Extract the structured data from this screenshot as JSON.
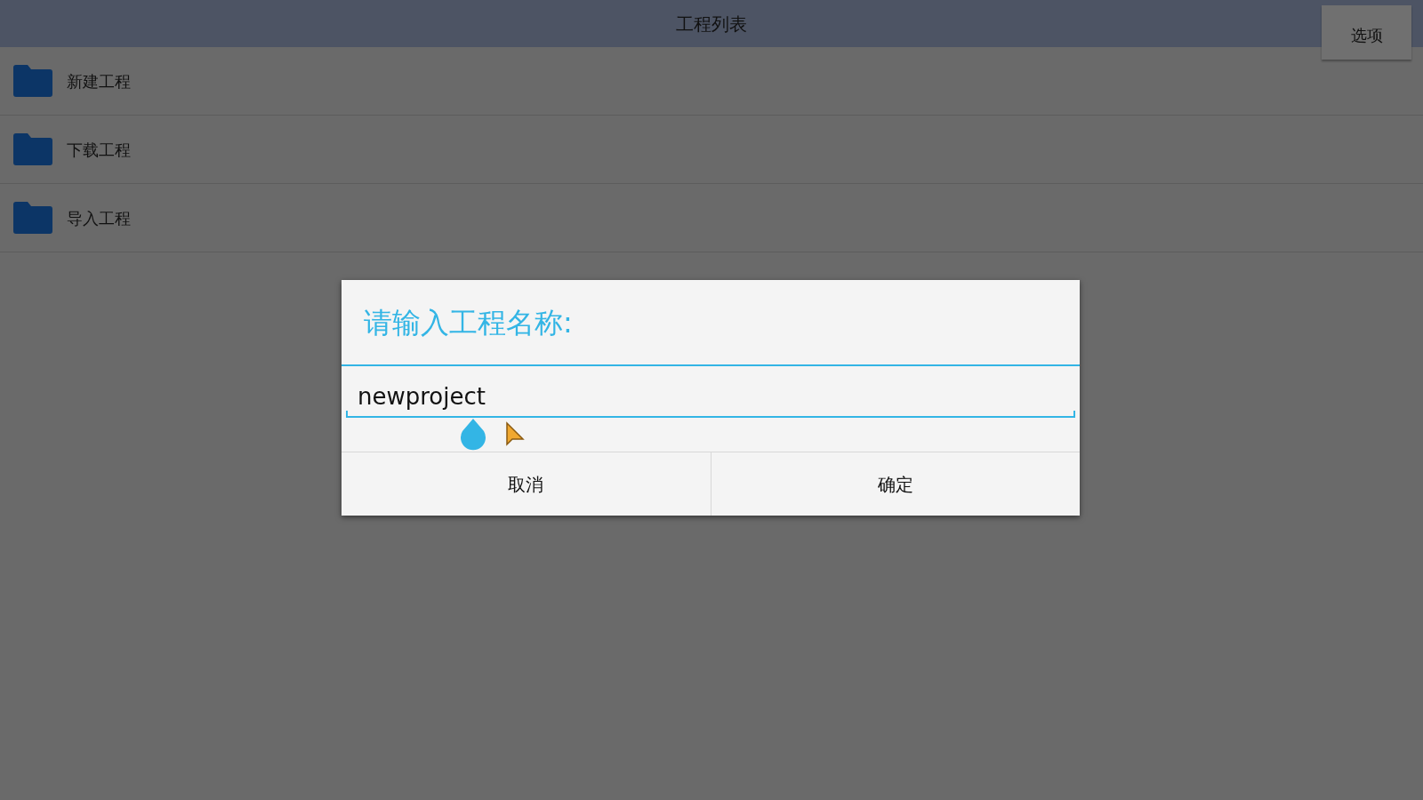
{
  "header": {
    "title": "工程列表",
    "menu_button": "选项"
  },
  "items": [
    {
      "label": "新建工程"
    },
    {
      "label": "下载工程"
    },
    {
      "label": "导入工程"
    }
  ],
  "dialog": {
    "title": "请输入工程名称:",
    "input": {
      "value": "newproject"
    },
    "buttons": [
      "取消",
      "确定"
    ]
  }
}
